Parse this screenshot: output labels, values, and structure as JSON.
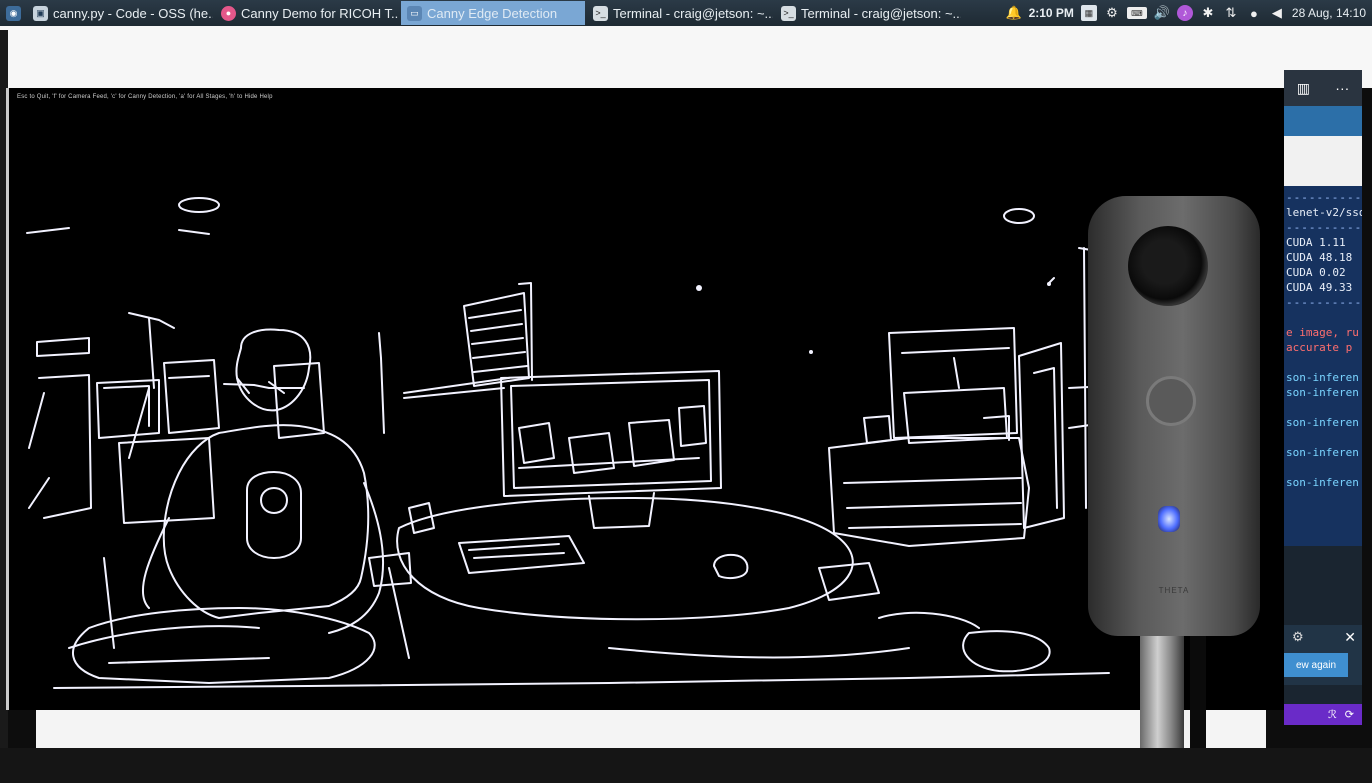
{
  "taskbar": {
    "tasks": [
      {
        "label": "canny.py - Code - OSS (he...",
        "icon": "code-oss-icon",
        "active": false
      },
      {
        "label": "Canny Demo for RICOH T...",
        "icon": "browser-icon",
        "active": false
      },
      {
        "label": "Canny Edge Detection",
        "icon": "window-icon",
        "active": true
      },
      {
        "label": "Terminal - craig@jetson: ~...",
        "icon": "terminal-icon",
        "active": false
      },
      {
        "label": "Terminal - craig@jetson: ~...",
        "icon": "terminal-icon",
        "active": false
      }
    ],
    "time": "2:10 PM",
    "date": "28 Aug, 14:10"
  },
  "canny_window": {
    "hint": "Esc to Quit, 'f' for Camera Feed, 'c' for Canny Detection, 'a' for All Stages, 'h' to Hide Help"
  },
  "side_panel": {
    "header_icons": [
      "split-editor-icon",
      "more-icon"
    ],
    "terminal_lines": [
      {
        "text": "-----------------",
        "cls": "dashes"
      },
      {
        "text": "lenet-v2/ssd",
        "cls": ""
      },
      {
        "text": "-----------------",
        "cls": "dashes"
      },
      {
        "text": "CUDA   1.11",
        "cls": ""
      },
      {
        "text": "CUDA  48.18",
        "cls": ""
      },
      {
        "text": "CUDA   0.02",
        "cls": ""
      },
      {
        "text": "CUDA  49.33",
        "cls": ""
      },
      {
        "text": "-----------------",
        "cls": "dashes"
      },
      {
        "text": "",
        "cls": ""
      },
      {
        "text": "e image, ru",
        "cls": "warn"
      },
      {
        "text": " accurate p",
        "cls": "warn"
      },
      {
        "text": "",
        "cls": ""
      },
      {
        "text": "son-inferen",
        "cls": "cyan"
      },
      {
        "text": "son-inferen",
        "cls": "cyan"
      },
      {
        "text": "",
        "cls": ""
      },
      {
        "text": "son-inferen",
        "cls": "cyan"
      },
      {
        "text": "",
        "cls": ""
      },
      {
        "text": "son-inferen",
        "cls": "cyan"
      },
      {
        "text": "",
        "cls": ""
      },
      {
        "text": "son-inferen",
        "cls": "cyan"
      }
    ],
    "notification_button": "ew again",
    "footer_icons": [
      "remote-icon",
      "sync-icon"
    ]
  },
  "camera": {
    "brand": "THETA"
  },
  "colors": {
    "taskbar": "#243340",
    "active_task": "#7aa7d4",
    "terminal_bg": "#16325f",
    "edge_line": "#f2f2ff",
    "led": "#4c6cff"
  }
}
